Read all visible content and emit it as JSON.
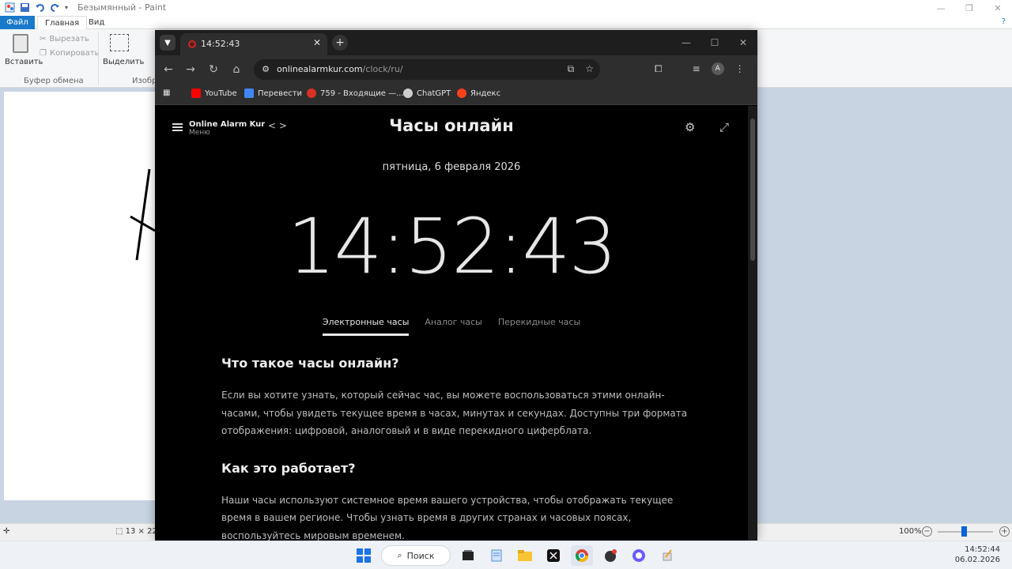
{
  "paint": {
    "title": "Безымянный - Paint",
    "tabs": {
      "file": "Файл",
      "home": "Главная",
      "view": "Вид"
    },
    "ribbon": {
      "paste": "Вставить",
      "cut": "Вырезать",
      "copy": "Копировать",
      "clipboard_group": "Буфер обмена",
      "select": "Выделить",
      "image_group_partial": "Изобр"
    },
    "status": {
      "size_partial": "13 × 22",
      "zoom": "100%"
    }
  },
  "chrome": {
    "tab_title": "14:52:43",
    "url_host": "onlinealarmkur.com",
    "url_path": "/clock/ru/",
    "bookmarks": [
      {
        "label": "YouTube",
        "color": "#ff0000"
      },
      {
        "label": "Перевести",
        "color": "#4285f4"
      },
      {
        "label": "759 - Входящие —...",
        "color": "#d93025"
      },
      {
        "label": "ChatGPT",
        "color": "#cfcfcf"
      },
      {
        "label": "Яндекс",
        "color": "#fc3f1d"
      }
    ],
    "avatar_letter": "A"
  },
  "site": {
    "name": "Online Alarm Kur",
    "menu_label": "Меню",
    "title": "Часы онлайн",
    "date": "пятница, 6 февраля 2026",
    "time": "14:52:43",
    "modes": [
      "Электронные часы",
      "Аналог часы",
      "Перекидные часы"
    ],
    "active_mode": "Электронные часы",
    "sections": [
      {
        "heading": "Что такое часы онлайн?",
        "text": "Если вы хотите узнать, который сейчас час, вы можете воспользоваться этими онлайн-часами, чтобы увидеть текущее время в часах, минутах и секундах. Доступны три формата отображения: цифровой, аналоговый и в виде перекидного циферблата."
      },
      {
        "heading": "Как это работает?",
        "text": "Наши часы используют системное время вашего устройства, чтобы отображать текущее время в вашем регионе. Чтобы узнать время в других странах и часовых поясах, воспользуйтесь мировым временем."
      }
    ]
  },
  "taskbar": {
    "search_label": "Поиск",
    "time": "14:52:44",
    "date": "06.02.2026"
  },
  "colors": {
    "paint_blue": "#1979ca",
    "chrome_dark": "#2e2e2e",
    "page_bg": "#000000",
    "canvas_bg": "#c9d4e3"
  }
}
